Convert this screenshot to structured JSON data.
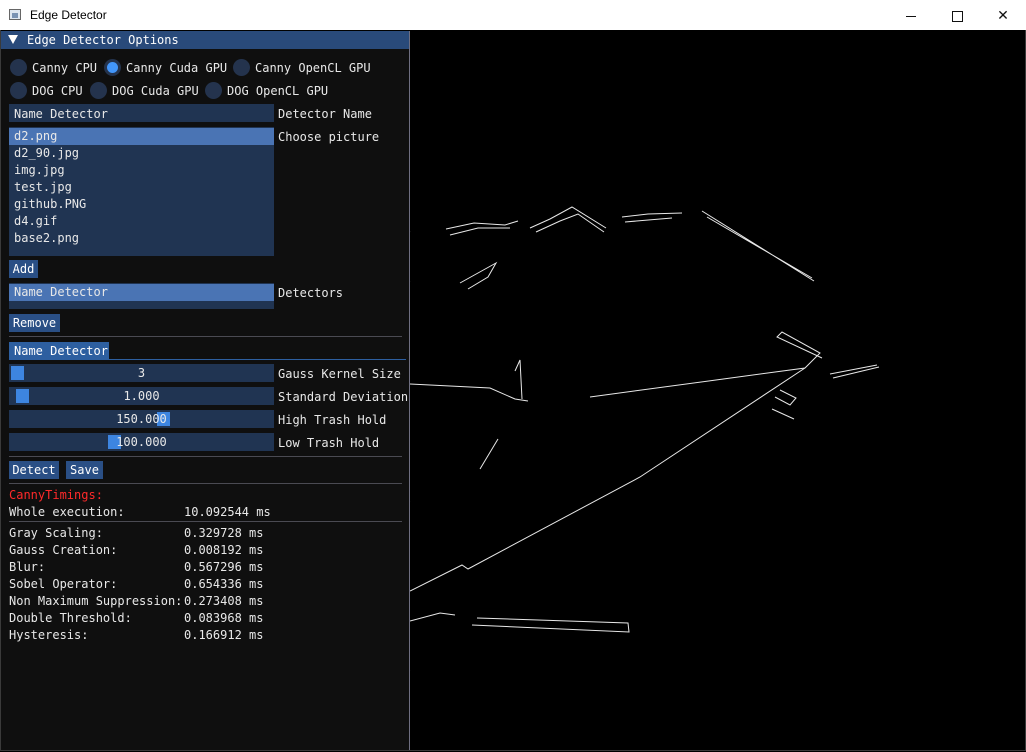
{
  "window": {
    "title": "Edge Detector"
  },
  "panel": {
    "header": "Edge Detector Options",
    "radios": [
      {
        "label": "Canny CPU",
        "checked": false
      },
      {
        "label": "Canny Cuda GPU",
        "checked": true
      },
      {
        "label": "Canny OpenCL GPU",
        "checked": false
      },
      {
        "label": "DOG CPU",
        "checked": false
      },
      {
        "label": "DOG Cuda GPU",
        "checked": false
      },
      {
        "label": "DOG OpenCL GPU",
        "checked": false
      }
    ],
    "name_input": {
      "value": "Name Detector",
      "label": "Detector Name"
    },
    "pictures": {
      "label": "Choose picture",
      "items": [
        "d2.png",
        "d2_90.jpg",
        "img.jpg",
        "test.jpg",
        "github.PNG",
        "d4.gif",
        "base2.png"
      ],
      "selected": "d2.png"
    },
    "add_button": "Add",
    "detectors": {
      "label": "Detectors",
      "items": [
        "Name Detector"
      ]
    },
    "remove_button": "Remove",
    "tab": "Name Detector",
    "sliders": [
      {
        "value": "3",
        "label": "Gauss Kernel Size",
        "fraction": 0.0
      },
      {
        "value": "1.000",
        "label": "Standard Deviation",
        "fraction": 0.02
      },
      {
        "value": "150.000",
        "label": "High Trash Hold",
        "fraction": 0.59
      },
      {
        "value": "100.000",
        "label": "Low Trash Hold",
        "fraction": 0.39
      }
    ],
    "detect_button": "Detect",
    "save_button": "Save",
    "timings": {
      "title": "CannyTimings:",
      "whole": {
        "label": "Whole execution:",
        "value": "10.092544 ms"
      },
      "rows": [
        {
          "label": "Gray Scaling:",
          "value": "0.329728 ms"
        },
        {
          "label": "Gauss Creation:",
          "value": "0.008192 ms"
        },
        {
          "label": "Blur:",
          "value": "0.567296 ms"
        },
        {
          "label": "Sobel Operator:",
          "value": "0.654336 ms"
        },
        {
          "label": "Non Maximum Suppression:",
          "value": "0.273408 ms"
        },
        {
          "label": "Double Threshold:",
          "value": "0.083968 ms"
        },
        {
          "label": "Hysteresis:",
          "value": "0.166912 ms"
        }
      ]
    }
  },
  "colors": {
    "header": "#294a7a",
    "accent": "#4296fa",
    "timings_title": "#ff2a2a"
  }
}
